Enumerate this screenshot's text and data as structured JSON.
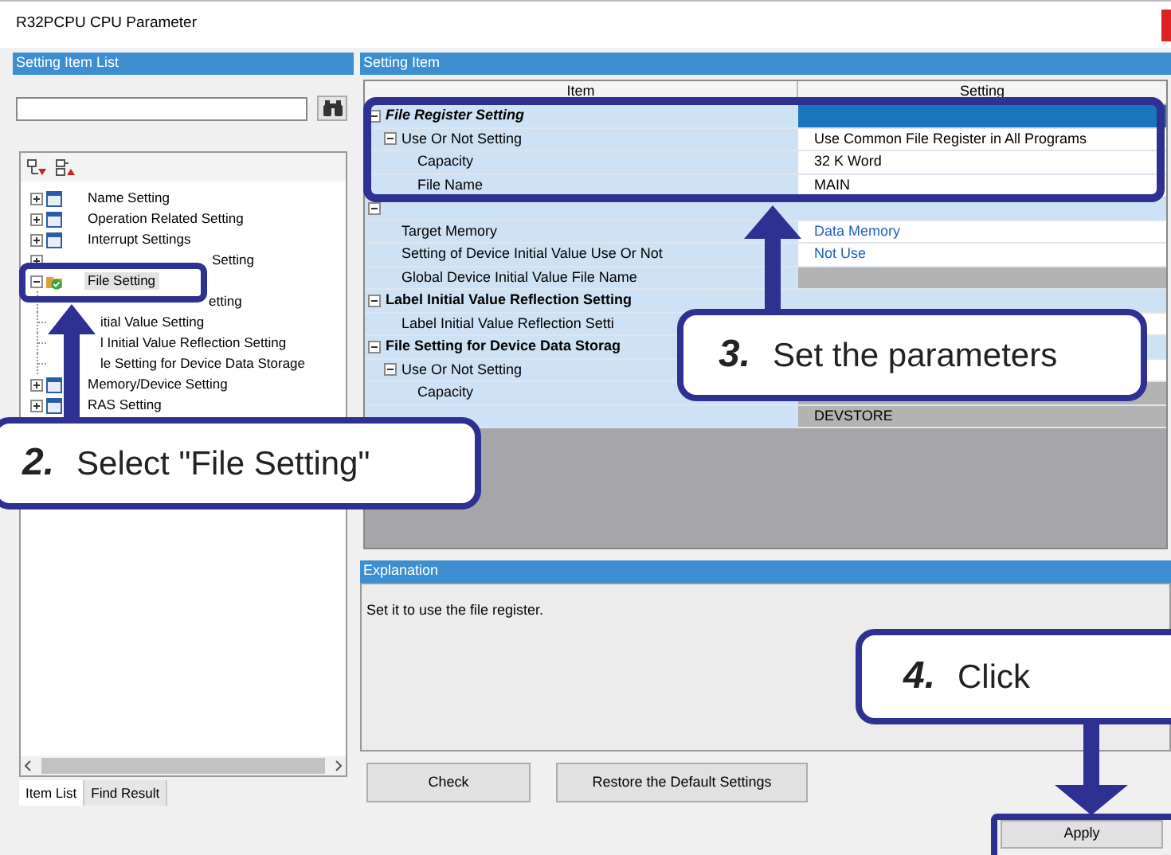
{
  "window": {
    "title": "R32PCPU CPU Parameter"
  },
  "left_panel": {
    "title": "Setting Item List"
  },
  "tree": [
    {
      "label": "Name Setting",
      "expanded": false,
      "selected": false
    },
    {
      "label": "Operation Related Setting",
      "expanded": false,
      "selected": false
    },
    {
      "label": "Interrupt Settings",
      "expanded": false,
      "selected": false
    },
    {
      "label": "Setting",
      "expanded": false,
      "selected": false
    },
    {
      "label": "File Setting",
      "expanded": true,
      "selected": true,
      "children": [
        {
          "label": "etting"
        },
        {
          "label": "itial Value Setting"
        },
        {
          "label": "l Initial Value Reflection Setting"
        },
        {
          "label": "le Setting for Device Data Storage"
        }
      ]
    },
    {
      "label": "Memory/Device Setting",
      "expanded": false,
      "selected": false
    },
    {
      "label": "RAS Setting",
      "expanded": false,
      "selected": false
    }
  ],
  "left_tabs": [
    {
      "label": "Item List",
      "selected": true
    },
    {
      "label": "Find Result",
      "selected": false
    }
  ],
  "right_panel": {
    "title": "Setting Item"
  },
  "grid": {
    "columns": [
      "Item",
      "Setting"
    ],
    "groups": [
      {
        "item": "File Register Setting",
        "selected": true,
        "expanded": true,
        "children": [
          {
            "item": "Use Or Not Setting",
            "value": "Use Common File Register in All Programs",
            "changed": false,
            "disabled": false,
            "expanded": true,
            "children": [
              {
                "item": "Capacity",
                "value": "32 K Word",
                "changed": false,
                "disabled": false
              },
              {
                "item": "File Name",
                "value": "MAIN",
                "changed": false,
                "disabled": false
              }
            ]
          }
        ]
      },
      {
        "selected": false,
        "expanded": true,
        "children": [
          {
            "item": "Target Memory",
            "value": "Data Memory",
            "changed": true,
            "disabled": false
          },
          {
            "item": "Setting of Device Initial Value Use Or Not",
            "value": "Not Use",
            "changed": true,
            "disabled": false
          },
          {
            "item": "Global Device Initial Value File Name",
            "disabled": true
          }
        ]
      },
      {
        "item": "Label Initial Value Reflection Setting",
        "selected": false,
        "expanded": true,
        "children": [
          {
            "item": "Label Initial Value Reflection Setti",
            "disabled": false
          }
        ]
      },
      {
        "item": "File Setting for Device Data Storag",
        "selected": false,
        "expanded": true,
        "children": [
          {
            "item": "Use Or Not Setting",
            "disabled": false,
            "expanded": true,
            "children": [
              {
                "item": "Capacity",
                "disabled": true
              },
              {
                "value": "DEVSTORE",
                "changed": false,
                "disabled": true
              }
            ]
          }
        ]
      }
    ]
  },
  "explanation": {
    "title": "Explanation",
    "text": "Set it to use the file register."
  },
  "buttons": [
    {
      "label": "Check"
    },
    {
      "label": "Restore the Default Settings"
    }
  ],
  "apply": {
    "label": "Apply"
  },
  "callouts": [
    {
      "number": "2.",
      "text": "Select \"File Setting\""
    },
    {
      "number": "3.",
      "text": "Set the parameters"
    },
    {
      "number": "4.",
      "text": "Click"
    }
  ]
}
